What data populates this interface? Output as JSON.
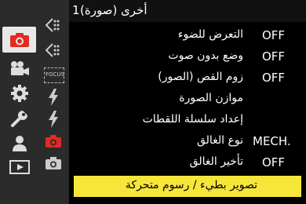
{
  "title": {
    "text": "أخرى (صورة)",
    "page_number": "1"
  },
  "left_tabs": [
    {
      "icon": "camera-icon",
      "active": true
    },
    {
      "icon": "video-camera-icon",
      "active": false
    },
    {
      "icon": "gear-icon",
      "active": false
    },
    {
      "icon": "wrench-icon",
      "active": false
    },
    {
      "icon": "person-icon",
      "active": false
    },
    {
      "icon": "playback-icon",
      "active": false
    }
  ],
  "sub_tabs": [
    {
      "icon": "bracket-dots-icon"
    },
    {
      "icon": "bracket-dots-alt-icon"
    },
    {
      "icon": "focus-icon",
      "label": "FOCUS"
    },
    {
      "icon": "flash-icon"
    },
    {
      "icon": "flash-alt-icon"
    },
    {
      "icon": "camera-red-icon",
      "active": true
    },
    {
      "icon": "camera-alt-icon"
    }
  ],
  "menu": [
    {
      "label": "التعرض للضوء",
      "value": "OFF"
    },
    {
      "label": "وضع بدون صوت",
      "value": "OFF"
    },
    {
      "label": "زوم القص (الصور)",
      "value": "OFF"
    },
    {
      "label": "موازن الصورة",
      "value": ""
    },
    {
      "label": "إعداد سلسلة اللقطات",
      "value": ""
    },
    {
      "label": "نوع الغالق",
      "value": "MECH."
    },
    {
      "label": "تأخير الغالق",
      "value": "OFF"
    },
    {
      "label": "تصوير بطيء / رسوم متحركة",
      "value": "",
      "highlighted": true
    }
  ],
  "colors": {
    "accent": "#e32a22",
    "highlight": "#f7e63a"
  }
}
